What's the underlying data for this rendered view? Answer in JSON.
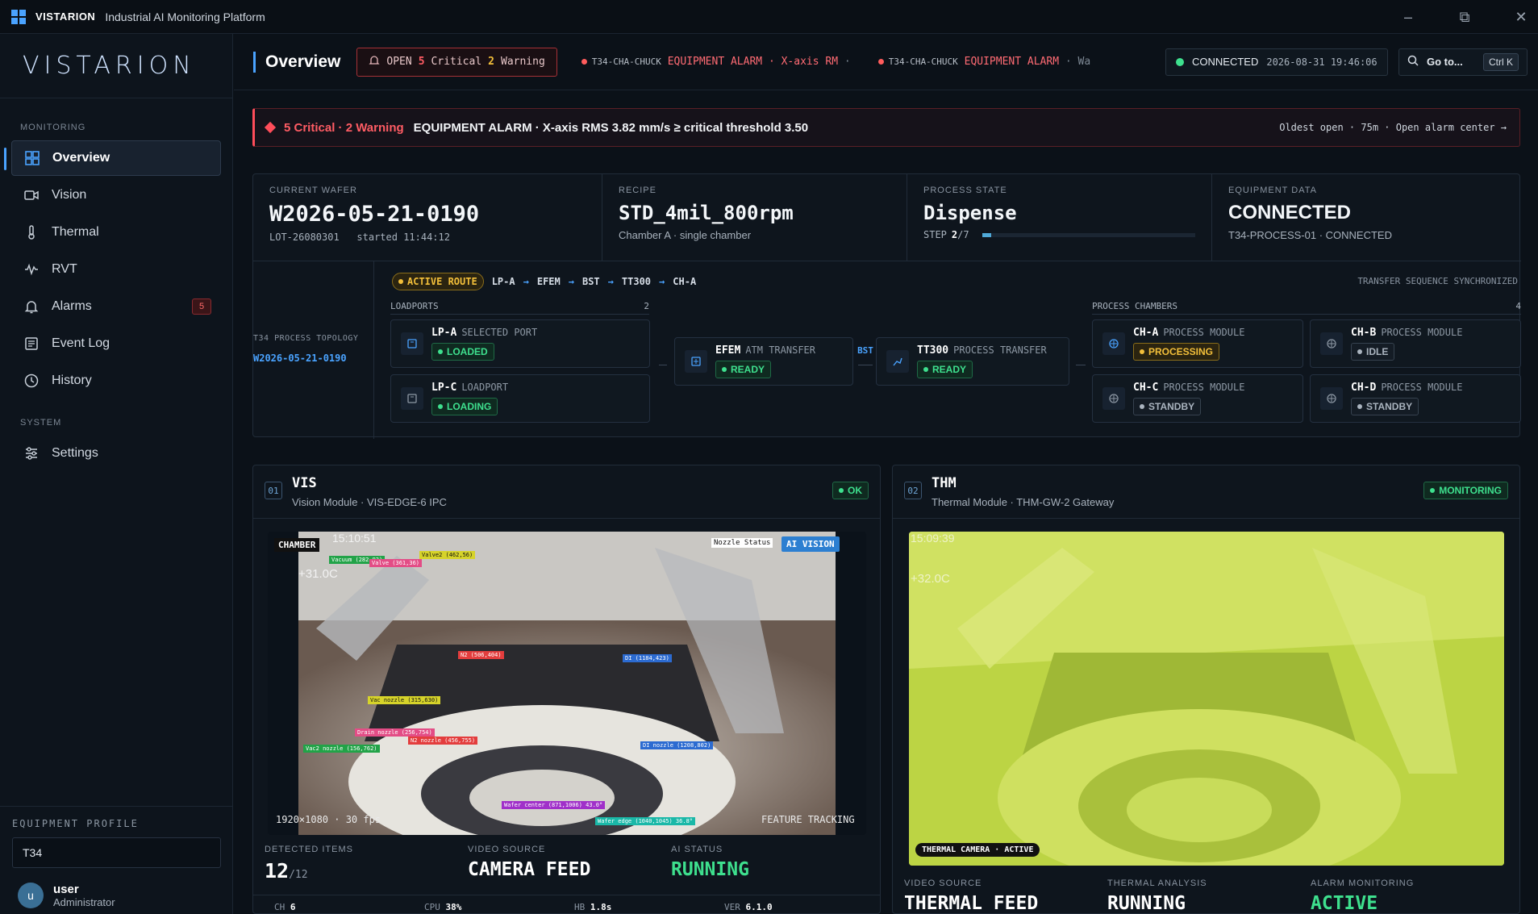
{
  "titlebar": {
    "brand": "VISTARION",
    "title": "Industrial AI Monitoring Platform"
  },
  "sidebar": {
    "logo": "VISTARION",
    "monitoring_label": "MONITORING",
    "system_label": "SYSTEM",
    "items": [
      {
        "label": "Overview",
        "icon": "grid-icon"
      },
      {
        "label": "Vision",
        "icon": "camera-icon"
      },
      {
        "label": "Thermal",
        "icon": "thermometer-icon"
      },
      {
        "label": "RVT",
        "icon": "waveform-icon"
      },
      {
        "label": "Alarms",
        "icon": "bell-icon",
        "badge": "5"
      },
      {
        "label": "Event Log",
        "icon": "list-icon"
      },
      {
        "label": "History",
        "icon": "clock-icon"
      }
    ],
    "settings": "Settings",
    "profile": {
      "label": "EQUIPMENT PROFILE",
      "value": "T34",
      "user": "user",
      "role": "Administrator",
      "avatar": "u"
    }
  },
  "header": {
    "title": "Overview",
    "open": "OPEN",
    "critical_count": "5",
    "critical_label": "Critical",
    "warning_count": "2",
    "warning_label": "Warning",
    "ticker": [
      {
        "src": "T34-CHA-CHUCK",
        "msg": "EQUIPMENT ALARM · X-axis RM",
        "trail": "·"
      },
      {
        "src": "T34-CHA-CHUCK",
        "msg": "EQUIPMENT ALARM",
        "trail": "· Wa"
      }
    ],
    "connection": "CONNECTED",
    "datetime": "2026-08-31 19:46:06",
    "goto": "Go to...",
    "shortcut": "Ctrl K"
  },
  "alert": {
    "counts": "5 Critical · 2 Warning",
    "message": "EQUIPMENT ALARM · X-axis RMS 3.82 mm/s ≥ critical threshold 3.50",
    "oldest": "Oldest open  ·  75m  ·  Open alarm center →"
  },
  "summary": {
    "wafer": {
      "label": "CURRENT WAFER",
      "value": "W2026-05-21-0190",
      "lot": "LOT-26080301",
      "started": "started 11:44:12"
    },
    "recipe": {
      "label": "RECIPE",
      "value": "STD_4mil_800rpm",
      "sub": "Chamber A · single chamber"
    },
    "process": {
      "label": "PROCESS STATE",
      "value": "Dispense",
      "step_label": "STEP",
      "step": "2",
      "step_total": "/7",
      "progress": 0.2857
    },
    "equipment": {
      "label": "EQUIPMENT DATA",
      "value": "CONNECTED",
      "sub": "T34-PROCESS-01 · CONNECTED"
    }
  },
  "topology": {
    "title": "T34 PROCESS TOPOLOGY",
    "wafer": "W2026-05-21-0190",
    "route_label": "ACTIVE ROUTE",
    "route": [
      "LP-A",
      "EFEM",
      "BST",
      "TT300",
      "CH-A"
    ],
    "sync": "TRANSFER SEQUENCE SYNCHRONIZED",
    "loadports_label": "LOADPORTS",
    "loadports_count": "2",
    "chambers_label": "PROCESS CHAMBERS",
    "chambers_count": "4",
    "bst": "BST",
    "loadports": [
      {
        "name": "LP-A",
        "type": "SELECTED PORT",
        "status": "LOADED"
      },
      {
        "name": "LP-C",
        "type": "LOADPORT",
        "status": "LOADING"
      }
    ],
    "efem": {
      "name": "EFEM",
      "type": "ATM TRANSFER",
      "status": "READY"
    },
    "tt300": {
      "name": "TT300",
      "type": "PROCESS TRANSFER",
      "status": "READY"
    },
    "chambers": [
      {
        "name": "CH-A",
        "type": "PROCESS MODULE",
        "status": "PROCESSING"
      },
      {
        "name": "CH-B",
        "type": "PROCESS MODULE",
        "status": "IDLE"
      },
      {
        "name": "CH-C",
        "type": "PROCESS MODULE",
        "status": "STANDBY"
      },
      {
        "name": "CH-D",
        "type": "PROCESS MODULE",
        "status": "STANDBY"
      }
    ]
  },
  "vis": {
    "num": "01",
    "title": "VIS",
    "sub": "Vision Module · VIS-EDGE-6 IPC",
    "status": "OK",
    "chamber": "CHAMBER",
    "time": "15:10:51",
    "temp": "+31.0C",
    "ai": "AI VISION",
    "nozzle": "Nozzle Status",
    "res": "1920×1080 · 30 fps",
    "tracking": "FEATURE TRACKING",
    "detections": [
      "Vacuum (282,93)",
      "Valve (361,36)",
      "Valve2 (462,56)",
      "N2 (506,404)",
      "DI (1184,423)",
      "Vac nozzle (315,630)",
      "Drain nozzle (256,754)",
      "N2 nozzle (456,755)",
      "DI nozzle (1208,802)",
      "Vac2 nozzle (156,762)",
      "Wafer center (871,1006) 43.0°",
      "Wafer edge (1040,1045) 36.8°"
    ],
    "stats": [
      {
        "label": "DETECTED ITEMS",
        "value": "12",
        "suffix": "/12"
      },
      {
        "label": "VIDEO SOURCE",
        "value": "CAMERA FEED"
      },
      {
        "label": "AI STATUS",
        "value": "RUNNING"
      }
    ],
    "foot": [
      {
        "k": "CH",
        "v": "6"
      },
      {
        "k": "CPU",
        "v": "38%"
      },
      {
        "k": "HB",
        "v": "1.8s"
      },
      {
        "k": "VER",
        "v": "6.1.0"
      }
    ]
  },
  "thm": {
    "num": "02",
    "title": "THM",
    "sub": "Thermal Module · THM-GW-2 Gateway",
    "status": "MONITORING",
    "time": "15:09:39",
    "temp": "+32.0C",
    "cam": "THERMAL CAMERA · ACTIVE",
    "stats": [
      {
        "label": "VIDEO SOURCE",
        "value": "THERMAL FEED"
      },
      {
        "label": "THERMAL ANALYSIS",
        "value": "RUNNING"
      },
      {
        "label": "ALARM MONITORING",
        "value": "ACTIVE"
      }
    ]
  },
  "colors": {
    "accent": "#4aa3ff",
    "critical": "#ff4d5a",
    "ok": "#3ee08e",
    "warn": "#f3bf3a"
  }
}
